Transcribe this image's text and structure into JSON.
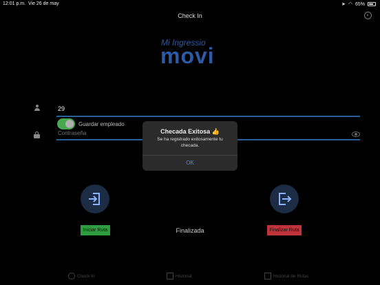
{
  "status_bar": {
    "time": "12:01 p.m.",
    "date": "Vie 26 de may",
    "battery": "65%"
  },
  "nav": {
    "title": "Check In"
  },
  "logo": {
    "small_text": "Mi Ingressio",
    "big_text": "movi"
  },
  "form": {
    "user_value": "29",
    "save_employee_label": "Guardar empleado",
    "save_employee_on": true,
    "password_placeholder": "Contraseña"
  },
  "actions": {
    "start_route_label": "Iniciar Ruta",
    "end_route_label": "Finalizar Ruta",
    "status_text": "Finalizada",
    "colors": {
      "start": "#2e9c3f",
      "end": "#c0333a"
    }
  },
  "modal": {
    "title": "Checada Exitosa 👍",
    "message": "Se ha registrado exitosamente tu checada.",
    "ok_label": "OK"
  },
  "tabs": [
    {
      "label": "Check In",
      "icon": "clock-icon"
    },
    {
      "label": "Historial",
      "icon": "calendar-icon"
    },
    {
      "label": "Historial de Rutas",
      "icon": "map-icon"
    }
  ]
}
